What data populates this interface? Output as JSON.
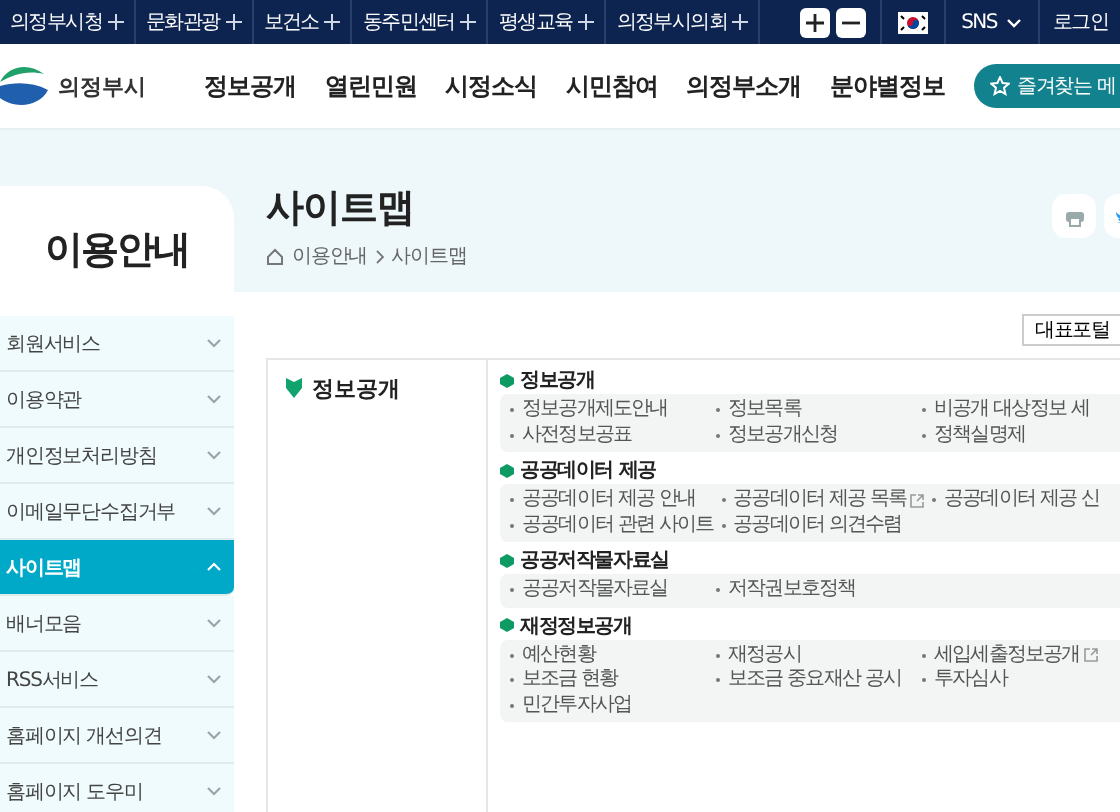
{
  "top_bar": {
    "links": [
      "의정부시청",
      "문화관광",
      "보건소",
      "동주민센터",
      "평생교육",
      "의정부시의회"
    ],
    "sns": "SNS",
    "login": "로그인"
  },
  "header": {
    "logo_text": "의정부시",
    "nav": [
      "정보공개",
      "열린민원",
      "시정소식",
      "시민참여",
      "의정부소개",
      "분야별정보"
    ],
    "favorites": "즐겨찾는 메"
  },
  "sidebar": {
    "title": "이용안내",
    "items": [
      {
        "label": "회원서비스",
        "selected": false
      },
      {
        "label": "이용약관",
        "selected": false
      },
      {
        "label": "개인정보처리방침",
        "selected": false
      },
      {
        "label": "이메일무단수집거부",
        "selected": false
      },
      {
        "label": "사이트맵",
        "selected": true
      },
      {
        "label": "배너모음",
        "selected": false
      },
      {
        "label": "RSS서비스",
        "selected": false
      },
      {
        "label": "홈페이지 개선의견",
        "selected": false
      },
      {
        "label": "홈페이지 도우미",
        "selected": false
      }
    ]
  },
  "page": {
    "title": "사이트맵",
    "breadcrumb": [
      "이용안내",
      "사이트맵"
    ],
    "portal_button": "대표포털"
  },
  "sitemap": {
    "category": "정보공개",
    "sections": [
      {
        "title": "정보공개",
        "links": [
          {
            "label": "정보공개제도안내",
            "external": false
          },
          {
            "label": "정보목록",
            "external": false
          },
          {
            "label": "비공개 대상정보 세",
            "external": false
          },
          {
            "label": "사전정보공표",
            "external": false
          },
          {
            "label": "정보공개신청",
            "external": false
          },
          {
            "label": "정책실명제",
            "external": false
          }
        ]
      },
      {
        "title": "공공데이터 제공",
        "links": [
          {
            "label": "공공데이터 제공 안내",
            "external": false
          },
          {
            "label": "공공데이터 제공 목록",
            "external": true
          },
          {
            "label": "공공데이터 제공 신",
            "external": false
          },
          {
            "label": "공공데이터 관련 사이트",
            "external": false
          },
          {
            "label": "공공데이터 의견수렴",
            "external": false
          }
        ]
      },
      {
        "title": "공공저작물자료실",
        "links": [
          {
            "label": "공공저작물자료실",
            "external": false
          },
          {
            "label": "저작권보호정책",
            "external": false
          }
        ]
      },
      {
        "title": "재정정보공개",
        "links": [
          {
            "label": "예산현황",
            "external": false
          },
          {
            "label": "재정공시",
            "external": false
          },
          {
            "label": "세입세출정보공개",
            "external": true
          },
          {
            "label": "보조금 현황",
            "external": false
          },
          {
            "label": "보조금 중요재산 공시",
            "external": false
          },
          {
            "label": "투자심사",
            "external": false
          },
          {
            "label": "민간투자사업",
            "external": false
          }
        ]
      }
    ]
  }
}
